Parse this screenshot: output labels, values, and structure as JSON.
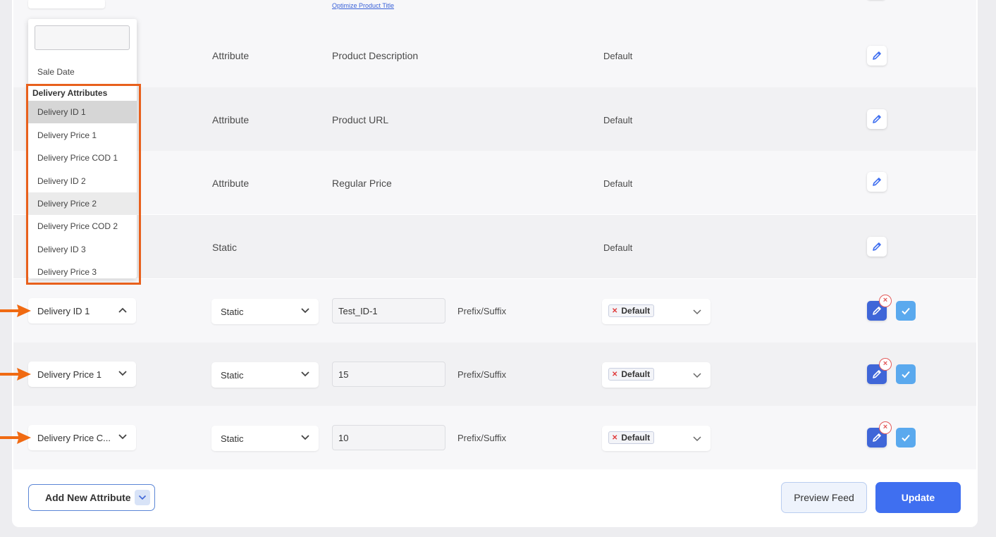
{
  "top": {
    "optimize_link": "Optimize Product Title"
  },
  "rows": [
    {
      "type": "Attribute",
      "value": "Product Description",
      "output": "Default"
    },
    {
      "type": "Attribute",
      "value": "Product URL",
      "output": "Default"
    },
    {
      "type": "Attribute",
      "value": "Regular Price",
      "output": "Default"
    },
    {
      "type": "Static",
      "value": "",
      "output": "Default"
    }
  ],
  "edit_rows": [
    {
      "attribute": "Delivery ID 1",
      "type": "Static",
      "value": "Test_ID-1",
      "prefix_suffix": "Prefix/Suffix",
      "output_tag": "Default"
    },
    {
      "attribute": "Delivery Price 1",
      "type": "Static",
      "value": "15",
      "prefix_suffix": "Prefix/Suffix",
      "output_tag": "Default"
    },
    {
      "attribute": "Delivery Price C...",
      "type": "Static",
      "value": "10",
      "prefix_suffix": "Prefix/Suffix",
      "output_tag": "Default"
    }
  ],
  "dropdown": {
    "prev_item": "Sale Date",
    "group_label": "Delivery Attributes",
    "items": [
      "Delivery ID 1",
      "Delivery Price 1",
      "Delivery Price COD 1",
      "Delivery ID 2",
      "Delivery Price 2",
      "Delivery Price COD 2",
      "Delivery ID 3",
      "Delivery Price 3"
    ]
  },
  "footer": {
    "add_attribute_label": "Add New Attribute",
    "preview_label": "Preview Feed",
    "update_label": "Update"
  },
  "colors": {
    "accent": "#3f6ff0",
    "highlight": "#e8601c",
    "check": "#5aa9ee"
  },
  "icons": [
    "pencil-icon",
    "check-icon",
    "close-icon",
    "chevron-down-icon",
    "chevron-up-icon",
    "arrow-right-icon"
  ]
}
